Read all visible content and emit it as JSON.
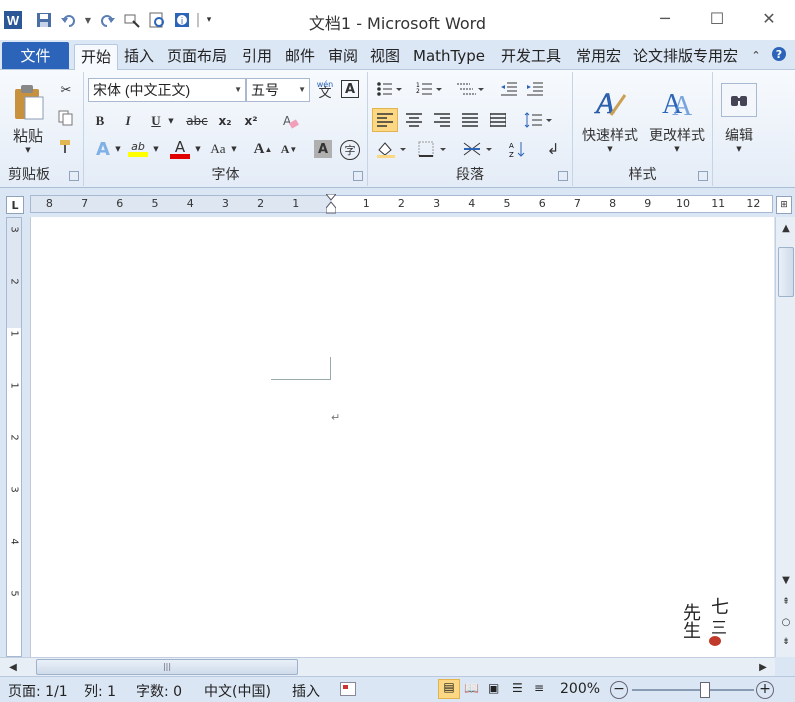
{
  "window": {
    "title": "文档1 - Microsoft Word"
  },
  "qat": {
    "icons": [
      "word-logo-icon",
      "save-icon",
      "undo-icon",
      "redo-icon",
      "format-painter-icon",
      "print-preview-icon",
      "help-icon",
      "customize-qat-icon"
    ]
  },
  "tabs": {
    "file": "文件",
    "items": [
      "开始",
      "插入",
      "页面布局",
      "引用",
      "邮件",
      "审阅",
      "视图",
      "MathType",
      "开发工具",
      "常用宏",
      "论文排版专用宏"
    ]
  },
  "ribbon": {
    "clipboard": {
      "paste_label": "粘贴",
      "group_label": "剪贴板"
    },
    "font": {
      "font_name": "宋体 (中文正文)",
      "font_size": "五号",
      "pinyin": "wén",
      "border_char": "A",
      "bold": "B",
      "italic": "I",
      "underline": "U",
      "strike": "abc",
      "sub": "x₂",
      "sup": "x²",
      "clear": "A",
      "text_effect": "A",
      "highlight": "ab",
      "font_color": "A",
      "change_case": "Aa",
      "grow": "A",
      "shrink": "A",
      "shading": "A",
      "enclose": "字",
      "group_label": "字体"
    },
    "paragraph": {
      "group_label": "段落"
    },
    "styles": {
      "quick_styles": "快速样式",
      "change_styles": "更改样式",
      "group_label": "样式"
    },
    "editing": {
      "label": "编辑"
    }
  },
  "ruler": {
    "h_left": [
      "8",
      "7",
      "6",
      "5",
      "4",
      "3",
      "2",
      "1"
    ],
    "h_right": [
      "1",
      "2",
      "3",
      "4",
      "5",
      "6",
      "7",
      "8",
      "9",
      "10",
      "11",
      "12"
    ],
    "v": [
      "3",
      "2",
      "1",
      "1",
      "2",
      "3",
      "4",
      "5"
    ]
  },
  "document": {
    "paragraph_mark": "↵",
    "watermark": "七三先生"
  },
  "status": {
    "page": "页面: 1/1",
    "column": "列: 1",
    "words": "字数: 0",
    "language": "中文(中国)",
    "mode": "插入",
    "zoom": "200%"
  },
  "colors": {
    "accent": "#2b64b8",
    "highlight": "#ffff00",
    "font_color": "#e00000"
  }
}
